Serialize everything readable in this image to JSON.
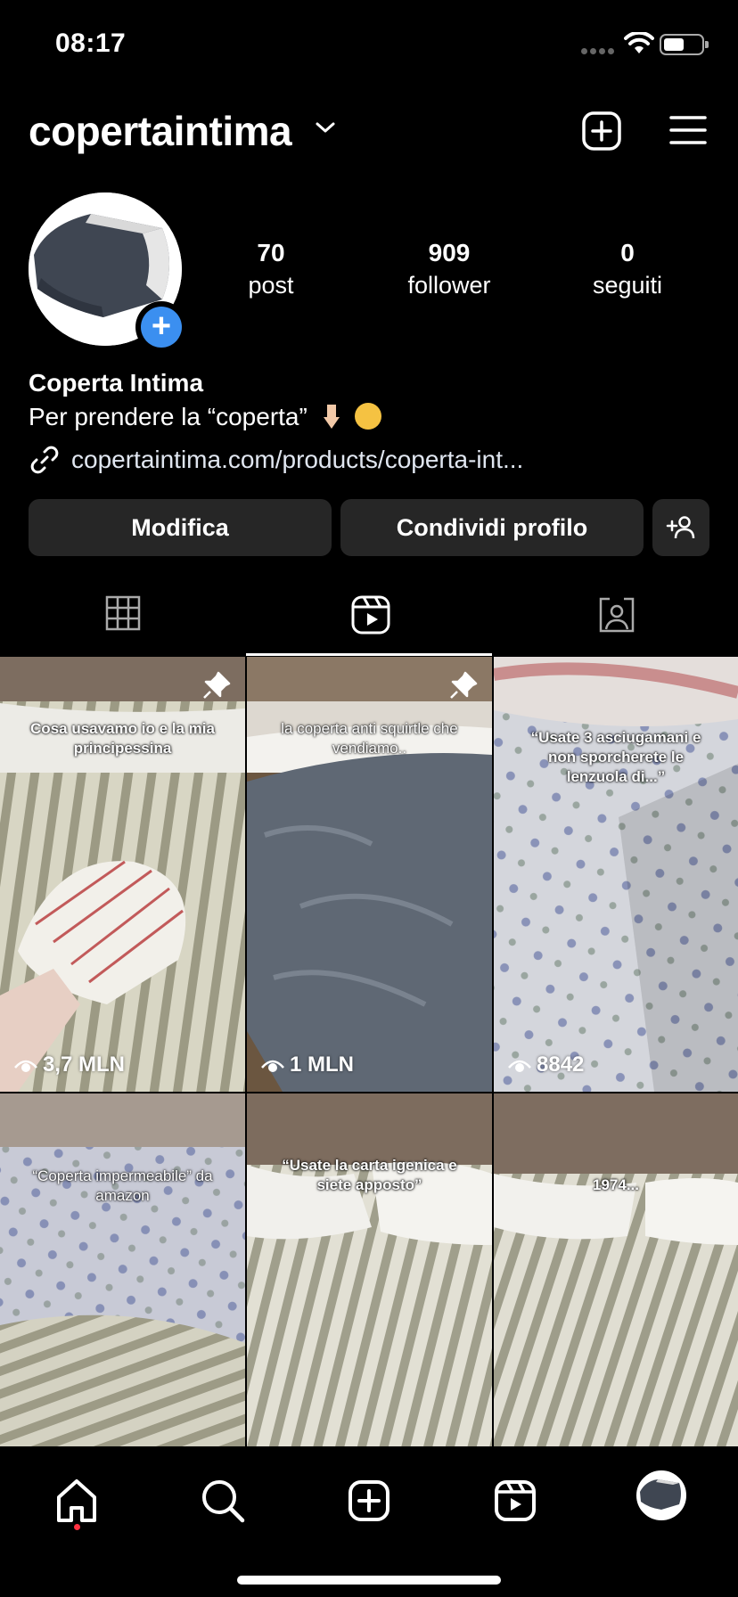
{
  "status_bar": {
    "time": "08:17"
  },
  "header": {
    "username": "copertaintima"
  },
  "profile": {
    "stats": [
      {
        "value": "70",
        "label": "post"
      },
      {
        "value": "909",
        "label": "follower"
      },
      {
        "value": "0",
        "label": "seguiti"
      }
    ],
    "full_name": "Coperta Intima",
    "bio": "Per prendere la “coperta”",
    "link": "copertaintima.com/products/coperta-int...",
    "avatar_add": "+"
  },
  "buttons": {
    "edit": "Modifica",
    "share": "Condividi profilo"
  },
  "tabs": [
    {
      "icon": "grid-icon",
      "active": false
    },
    {
      "icon": "reels-icon",
      "active": true
    },
    {
      "icon": "tagged-icon",
      "active": false
    }
  ],
  "reels": [
    {
      "caption": "Cosa usavamo io e la mia principessina",
      "views": "3,7 MLN",
      "pinned": true
    },
    {
      "caption": "la coperta anti squirtle che vendiamo..",
      "views": "1 MLN",
      "pinned": true
    },
    {
      "caption": "“Usate 3 asciugamani e non sporcherete le lenzuola di...”",
      "views": "8842",
      "pinned": false
    },
    {
      "caption": "“Coperta impermeabile” da amazon",
      "views": "",
      "pinned": false
    },
    {
      "caption": "“Usate la carta igenica e siete apposto”",
      "views": "",
      "pinned": false
    },
    {
      "caption": "1974...",
      "views": "",
      "pinned": false
    }
  ],
  "nav": [
    "home-icon",
    "search-icon",
    "create-icon",
    "reels-icon",
    "profile-avatar"
  ],
  "colors": {
    "accent_blue": "#3b8ff0",
    "button_bg": "#262626",
    "notification_red": "#ff3040"
  }
}
